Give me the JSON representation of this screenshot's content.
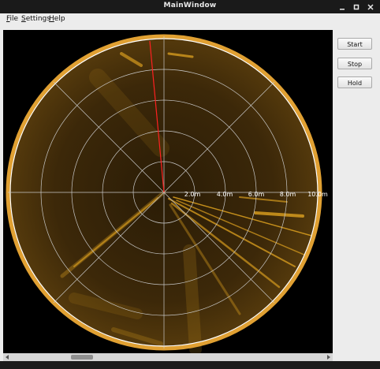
{
  "window": {
    "title": "MainWindow"
  },
  "menu": {
    "file": "File",
    "settings": "Settings",
    "help": "Help"
  },
  "buttons": {
    "start": "Start",
    "stop": "Stop",
    "hold": "Hold"
  },
  "sonar": {
    "range_labels": [
      "2.0m",
      "4.0m",
      "6.0m",
      "8.0m",
      "10.0m"
    ],
    "colors": {
      "background": "#000000",
      "echo": "#d49a1e",
      "rim": "#ffffff",
      "cursor": "#ff2020",
      "grid": "#c8c8c8"
    }
  },
  "icons": [
    "minimize-icon",
    "maximize-icon",
    "close-icon",
    "scroll-left-icon",
    "scroll-right-icon"
  ]
}
